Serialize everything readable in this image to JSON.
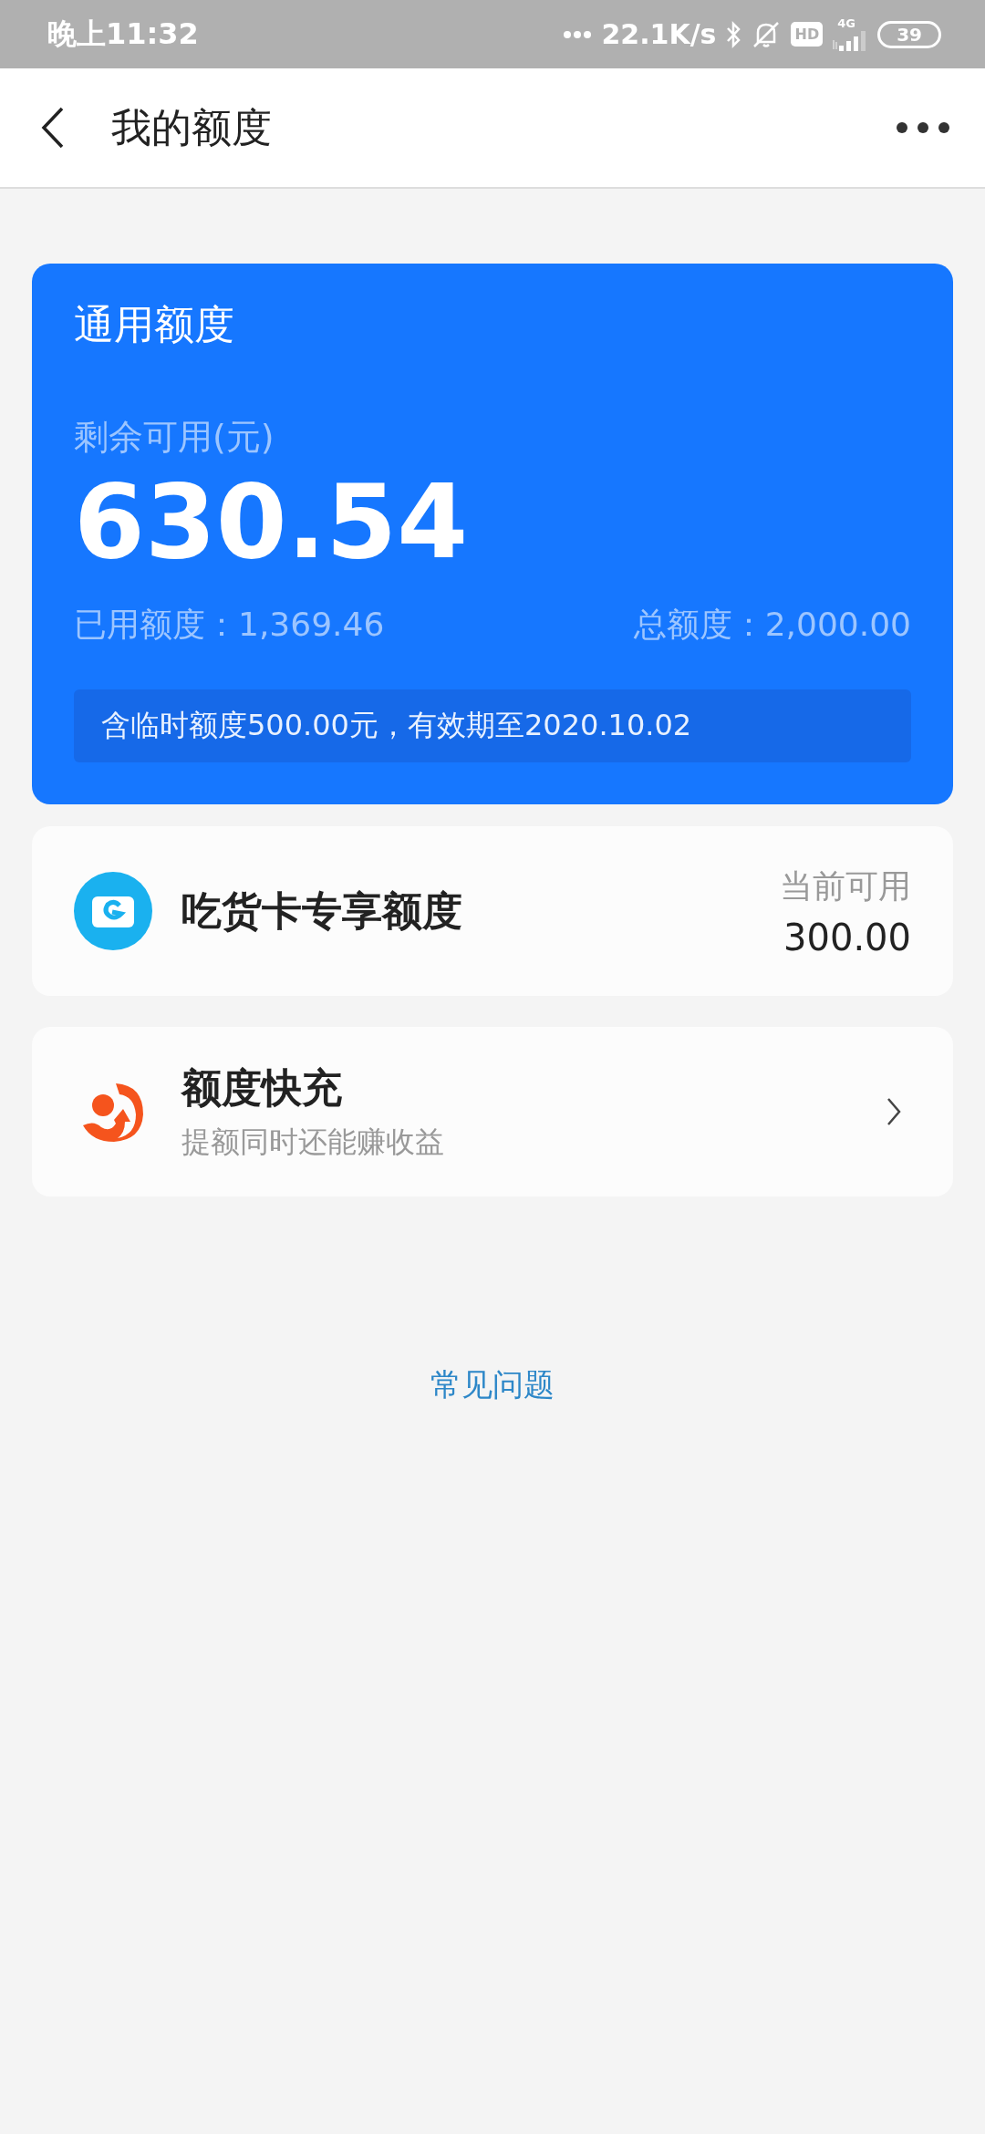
{
  "status_bar": {
    "time": "晚上11:32",
    "speed": "22.1K/s",
    "hd": "HD",
    "network": "4G",
    "battery": "39"
  },
  "nav": {
    "title": "我的额度"
  },
  "general": {
    "title": "通用额度",
    "remaining_label": "剩余可用(元)",
    "remaining": "630.54",
    "used": "已用额度：1,369.46",
    "total": "总额度：2,000.00",
    "note": "含临时额度500.00元，有效期至2020.10.02"
  },
  "items": [
    {
      "kind": "quota",
      "title": "吃货卡专享额度",
      "label": "当前可用",
      "value": "300.00"
    },
    {
      "kind": "link",
      "title": "额度快充",
      "subtitle": "提额同时还能赚收益"
    }
  ],
  "faq": "常见问题"
}
